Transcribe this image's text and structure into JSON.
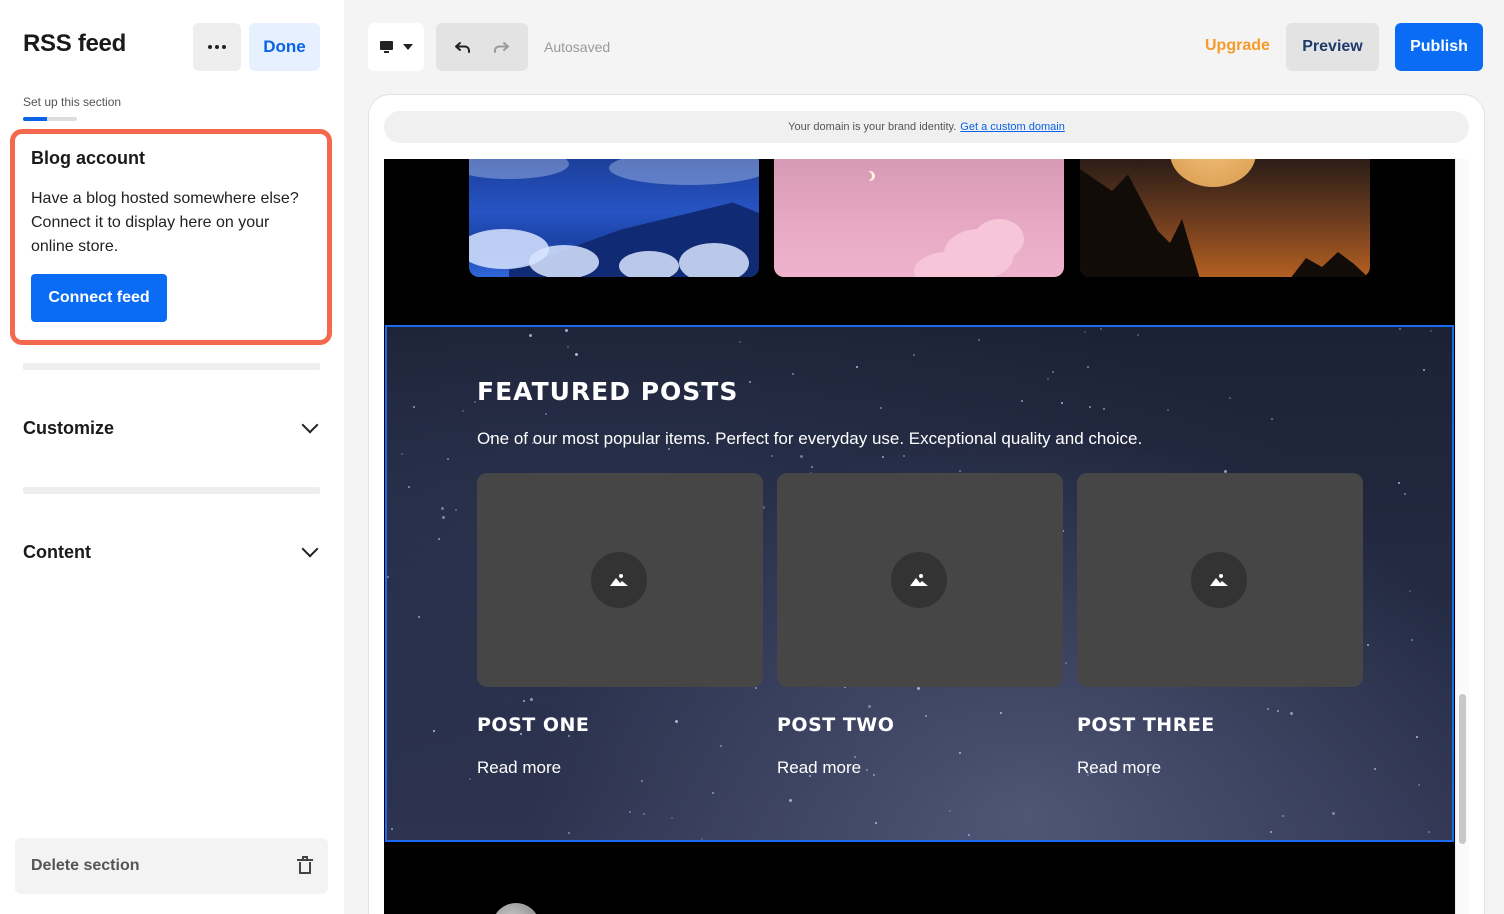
{
  "sidebar": {
    "title": "RSS feed",
    "more_icon": "more-horizontal-icon",
    "done_label": "Done",
    "setup_label": "Set up this section",
    "setup_progress": 0.45,
    "blog_card": {
      "heading": "Blog account",
      "description": "Have a blog hosted somewhere else? Connect it to display here on your online store.",
      "connect_label": "Connect feed"
    },
    "accordions": [
      {
        "label": "Customize"
      },
      {
        "label": "Content"
      }
    ],
    "delete_label": "Delete section"
  },
  "toolbar": {
    "device_icon": "desktop-icon",
    "autosaved": "Autosaved",
    "upgrade_label": "Upgrade",
    "preview_label": "Preview",
    "publish_label": "Publish"
  },
  "preview": {
    "domain_text": "Your domain is your brand identity.",
    "domain_link": "Get a custom domain",
    "featured": {
      "title": "Featured posts",
      "subtitle": "One of our most popular items. Perfect for everyday use. Exceptional quality and choice.",
      "posts": [
        {
          "title": "Post one",
          "read_more": "Read more"
        },
        {
          "title": "Post two",
          "read_more": "Read more"
        },
        {
          "title": "Post three",
          "read_more": "Read more"
        }
      ]
    }
  },
  "colors": {
    "accent": "#0a6cf5",
    "highlight": "#f4684d",
    "upgrade": "#f59b2a"
  }
}
